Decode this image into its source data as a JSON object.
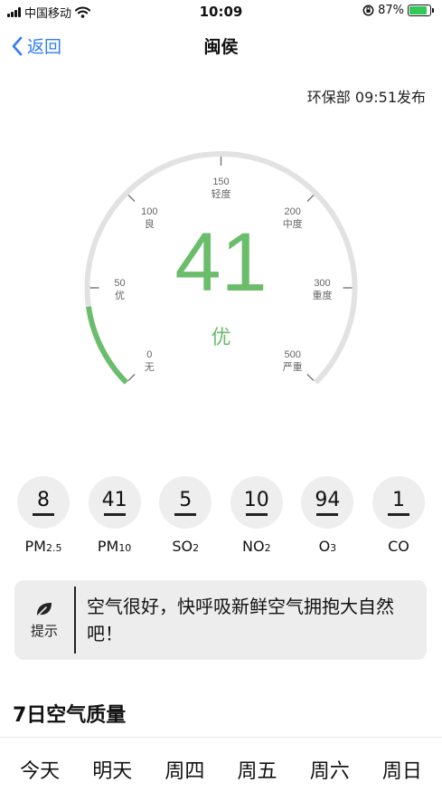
{
  "status_bar": {
    "carrier": "中国移动",
    "time": "10:09",
    "battery_percent": "87%",
    "battery_level": 0.87
  },
  "nav": {
    "back_label": "返回",
    "title": "闽侯"
  },
  "publish_info": "环保部 09:51发布",
  "gauge": {
    "value": 41,
    "max": 500,
    "active_color": "#6abd6a",
    "track_color": "#e2e2e2",
    "ticks": [
      {
        "value": "0",
        "label": "无"
      },
      {
        "value": "50",
        "label": "优"
      },
      {
        "value": "100",
        "label": "良"
      },
      {
        "value": "150",
        "label": "轻度"
      },
      {
        "value": "200",
        "label": "中度"
      },
      {
        "value": "300",
        "label": "重度"
      },
      {
        "value": "500",
        "label": "严重"
      }
    ]
  },
  "aqi": {
    "value": "41",
    "level": "优"
  },
  "pollutants": [
    {
      "value": "8",
      "name": "PM",
      "sub": "2.5"
    },
    {
      "value": "41",
      "name": "PM",
      "sub": "10"
    },
    {
      "value": "5",
      "name": "SO",
      "sub": "2"
    },
    {
      "value": "10",
      "name": "NO",
      "sub": "2"
    },
    {
      "value": "94",
      "name": "O",
      "sub": "3"
    },
    {
      "value": "1",
      "name": "CO",
      "sub": ""
    }
  ],
  "tip": {
    "label": "提示",
    "text": "空气很好，快呼吸新鲜空气拥抱大自然吧！"
  },
  "week": {
    "title": "7日空气质量",
    "days": [
      "今天",
      "明天",
      "周四",
      "周五",
      "周六",
      "周日"
    ]
  }
}
